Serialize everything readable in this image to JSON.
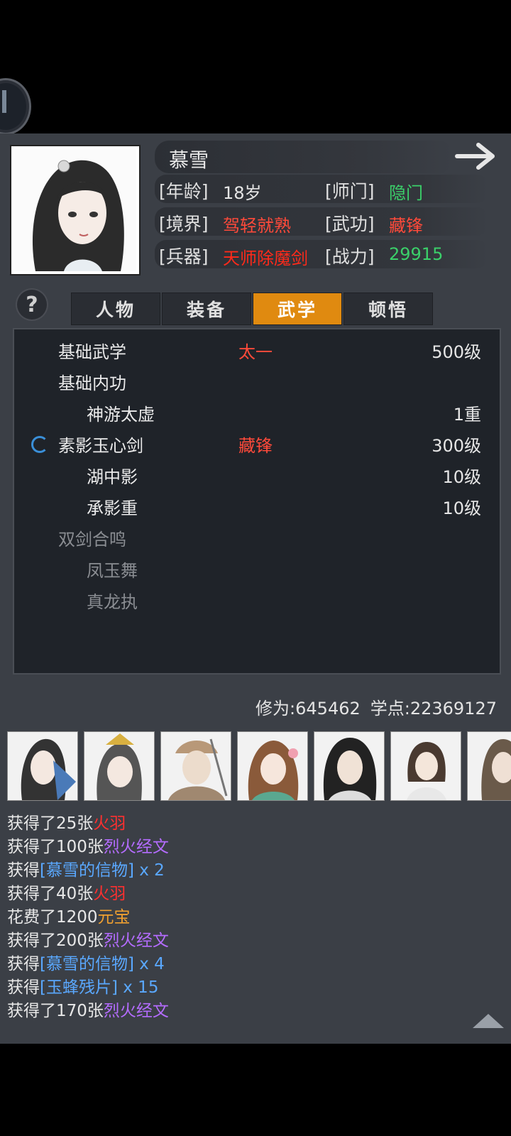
{
  "character": {
    "name": "慕雪",
    "attributes": [
      {
        "label": "[年龄]",
        "value": "18岁",
        "color": "white"
      },
      {
        "label": "[师门]",
        "value": "隐门",
        "color": "green"
      },
      {
        "label": "[境界]",
        "value": "驾轻就熟",
        "color": "red"
      },
      {
        "label": "[武功]",
        "value": "藏锋",
        "color": "red"
      },
      {
        "label": "[兵器]",
        "value": "天师除魔剑",
        "color": "redbright"
      },
      {
        "label": "[战力]",
        "value": "29915",
        "color": "green"
      }
    ]
  },
  "tabs": [
    {
      "label": "人物",
      "active": false
    },
    {
      "label": "装备",
      "active": false
    },
    {
      "label": "武学",
      "active": true
    },
    {
      "label": "顿悟",
      "active": false
    }
  ],
  "help_label": "?",
  "skills": [
    {
      "name": "基础武学",
      "tag": "太一",
      "level": "500级",
      "indent": false,
      "dim": false,
      "spinner": false
    },
    {
      "name": "基础内功",
      "tag": "",
      "level": "",
      "indent": false,
      "dim": false,
      "spinner": false
    },
    {
      "name": "神游太虚",
      "tag": "",
      "level": "1重",
      "indent": true,
      "dim": false,
      "spinner": false
    },
    {
      "name": "素影玉心剑",
      "tag": "藏锋",
      "level": "300级",
      "indent": false,
      "dim": false,
      "spinner": true
    },
    {
      "name": "湖中影",
      "tag": "",
      "level": "10级",
      "indent": true,
      "dim": false,
      "spinner": false
    },
    {
      "name": "承影重",
      "tag": "",
      "level": "10级",
      "indent": true,
      "dim": false,
      "spinner": false
    },
    {
      "name": "双剑合鸣",
      "tag": "",
      "level": "",
      "indent": false,
      "dim": true,
      "spinner": false
    },
    {
      "name": "凤玉舞",
      "tag": "",
      "level": "",
      "indent": true,
      "dim": true,
      "spinner": false
    },
    {
      "name": "真龙执",
      "tag": "",
      "level": "",
      "indent": true,
      "dim": true,
      "spinner": false
    }
  ],
  "stats": {
    "cultivation": "修为:645462",
    "points": "学点:22369127"
  },
  "log": [
    [
      {
        "t": "获得了25张",
        "c": ""
      },
      {
        "t": "火羽",
        "c": "c-red"
      }
    ],
    [
      {
        "t": "获得了100张",
        "c": ""
      },
      {
        "t": "烈火经文",
        "c": "c-purple"
      }
    ],
    [
      {
        "t": "获得",
        "c": ""
      },
      {
        "t": "[慕雪的信物]",
        "c": "c-blue"
      },
      {
        "t": " x 2",
        "c": "c-blue"
      }
    ],
    [
      {
        "t": "获得了40张",
        "c": ""
      },
      {
        "t": "火羽",
        "c": "c-red"
      }
    ],
    [
      {
        "t": "花费了1200",
        "c": ""
      },
      {
        "t": "元宝",
        "c": "c-orange"
      }
    ],
    [
      {
        "t": "获得了200张",
        "c": ""
      },
      {
        "t": "烈火经文",
        "c": "c-purple"
      }
    ],
    [
      {
        "t": "获得",
        "c": ""
      },
      {
        "t": "[慕雪的信物]",
        "c": "c-blue"
      },
      {
        "t": " x 4",
        "c": "c-blue"
      }
    ],
    [
      {
        "t": "获得",
        "c": ""
      },
      {
        "t": "[玉蜂残片]",
        "c": "c-blue"
      },
      {
        "t": " x 15",
        "c": "c-blue"
      }
    ],
    [
      {
        "t": "获得了170张",
        "c": ""
      },
      {
        "t": "烈火经文",
        "c": "c-purple"
      }
    ]
  ]
}
